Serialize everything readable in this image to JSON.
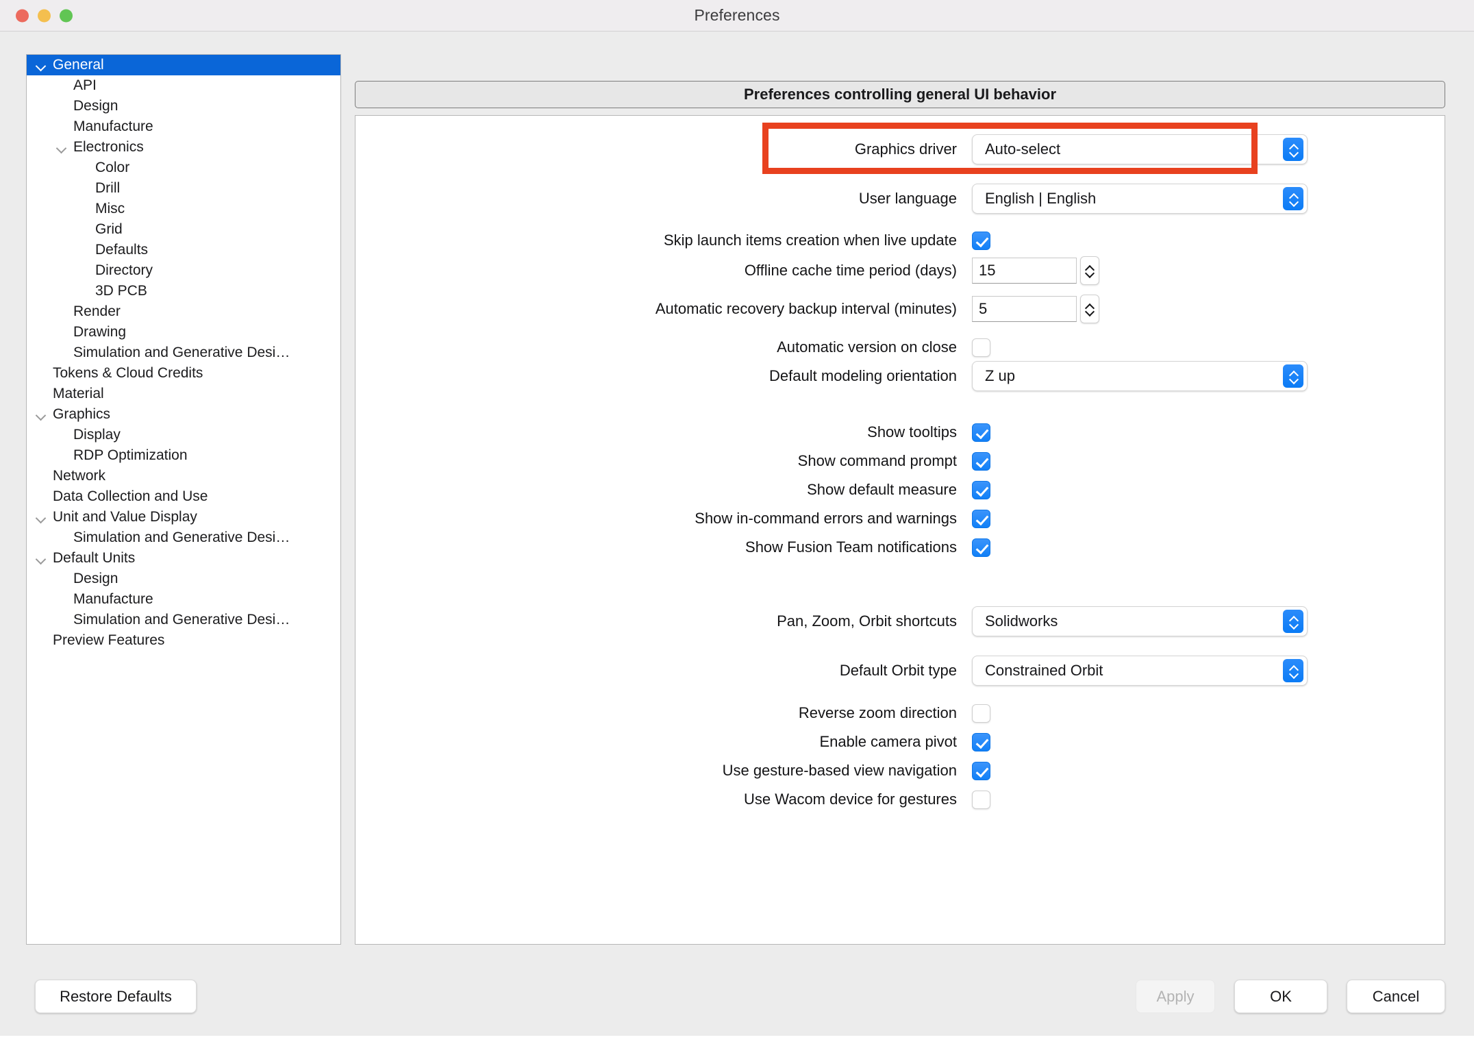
{
  "window": {
    "title": "Preferences",
    "traffic_lights": [
      "close",
      "minimize",
      "maximize"
    ]
  },
  "sidebar": {
    "items": [
      {
        "label": "General",
        "level": 0,
        "twisty": "expanded",
        "selected": true
      },
      {
        "label": "API",
        "level": 1,
        "twisty": "none",
        "selected": false
      },
      {
        "label": "Design",
        "level": 1,
        "twisty": "none",
        "selected": false
      },
      {
        "label": "Manufacture",
        "level": 1,
        "twisty": "none",
        "selected": false
      },
      {
        "label": "Electronics",
        "level": 1,
        "twisty": "expanded",
        "selected": false
      },
      {
        "label": "Color",
        "level": 2,
        "twisty": "none",
        "selected": false
      },
      {
        "label": "Drill",
        "level": 2,
        "twisty": "none",
        "selected": false
      },
      {
        "label": "Misc",
        "level": 2,
        "twisty": "none",
        "selected": false
      },
      {
        "label": "Grid",
        "level": 2,
        "twisty": "none",
        "selected": false
      },
      {
        "label": "Defaults",
        "level": 2,
        "twisty": "none",
        "selected": false
      },
      {
        "label": "Directory",
        "level": 2,
        "twisty": "none",
        "selected": false
      },
      {
        "label": "3D PCB",
        "level": 2,
        "twisty": "none",
        "selected": false
      },
      {
        "label": "Render",
        "level": 1,
        "twisty": "none",
        "selected": false
      },
      {
        "label": "Drawing",
        "level": 1,
        "twisty": "none",
        "selected": false
      },
      {
        "label": "Simulation and Generative Desi…",
        "level": 1,
        "twisty": "none",
        "selected": false
      },
      {
        "label": "Tokens & Cloud Credits",
        "level": 0,
        "twisty": "none",
        "selected": false
      },
      {
        "label": "Material",
        "level": 0,
        "twisty": "none",
        "selected": false
      },
      {
        "label": "Graphics",
        "level": 0,
        "twisty": "expanded",
        "selected": false
      },
      {
        "label": "Display",
        "level": 1,
        "twisty": "none",
        "selected": false
      },
      {
        "label": "RDP Optimization",
        "level": 1,
        "twisty": "none",
        "selected": false
      },
      {
        "label": "Network",
        "level": 0,
        "twisty": "none",
        "selected": false
      },
      {
        "label": "Data Collection and Use",
        "level": 0,
        "twisty": "none",
        "selected": false
      },
      {
        "label": "Unit and Value Display",
        "level": 0,
        "twisty": "expanded",
        "selected": false
      },
      {
        "label": "Simulation and Generative Desi…",
        "level": 1,
        "twisty": "none",
        "selected": false
      },
      {
        "label": "Default Units",
        "level": 0,
        "twisty": "expanded",
        "selected": false
      },
      {
        "label": "Design",
        "level": 1,
        "twisty": "none",
        "selected": false
      },
      {
        "label": "Manufacture",
        "level": 1,
        "twisty": "none",
        "selected": false
      },
      {
        "label": "Simulation and Generative Desi…",
        "level": 1,
        "twisty": "none",
        "selected": false
      },
      {
        "label": "Preview Features",
        "level": 0,
        "twisty": "none",
        "selected": false
      }
    ]
  },
  "main": {
    "header": "Preferences controlling general UI behavior",
    "fields": {
      "graphics_driver": {
        "label": "Graphics driver",
        "value": "Auto-select",
        "type": "select",
        "highlighted": true
      },
      "user_language": {
        "label": "User language",
        "value": "English | English",
        "type": "select"
      },
      "skip_launch": {
        "label": "Skip launch items creation when live update",
        "value": "checked",
        "type": "checkbox"
      },
      "offline_cache": {
        "label": "Offline cache time period (days)",
        "value": "15",
        "type": "spinner"
      },
      "recovery_backup": {
        "label": "Automatic recovery backup interval (minutes)",
        "value": "5",
        "type": "spinner"
      },
      "auto_version": {
        "label": "Automatic version on close",
        "value": "unchecked",
        "type": "checkbox"
      },
      "modeling_orient": {
        "label": "Default modeling orientation",
        "value": "Z up",
        "type": "select"
      },
      "show_tooltips": {
        "label": "Show tooltips",
        "value": "checked",
        "type": "checkbox"
      },
      "show_cmd_prompt": {
        "label": "Show command prompt",
        "value": "checked",
        "type": "checkbox"
      },
      "show_def_measure": {
        "label": "Show default measure",
        "value": "checked",
        "type": "checkbox"
      },
      "show_incmd_errors": {
        "label": "Show in-command errors and warnings",
        "value": "checked",
        "type": "checkbox"
      },
      "show_fusion_team": {
        "label": "Show Fusion Team notifications",
        "value": "checked",
        "type": "checkbox"
      },
      "pzo_shortcuts": {
        "label": "Pan, Zoom, Orbit shortcuts",
        "value": "Solidworks",
        "type": "select"
      },
      "orbit_type": {
        "label": "Default Orbit type",
        "value": "Constrained Orbit",
        "type": "select"
      },
      "reverse_zoom": {
        "label": "Reverse zoom direction",
        "value": "unchecked",
        "type": "checkbox"
      },
      "camera_pivot": {
        "label": "Enable camera pivot",
        "value": "checked",
        "type": "checkbox"
      },
      "gesture_nav": {
        "label": "Use gesture-based view navigation",
        "value": "checked",
        "type": "checkbox"
      },
      "wacom_gestures": {
        "label": "Use Wacom device for gestures",
        "value": "unchecked",
        "type": "checkbox"
      }
    }
  },
  "footer": {
    "restore_defaults": "Restore Defaults",
    "apply": "Apply",
    "ok": "OK",
    "cancel": "Cancel"
  },
  "colors": {
    "highlight_border": "#e8411f",
    "selection_blue": "#0a66d8",
    "control_blue": "#1180f7",
    "window_bg": "#ececec",
    "titlebar_bg": "#efedef"
  }
}
